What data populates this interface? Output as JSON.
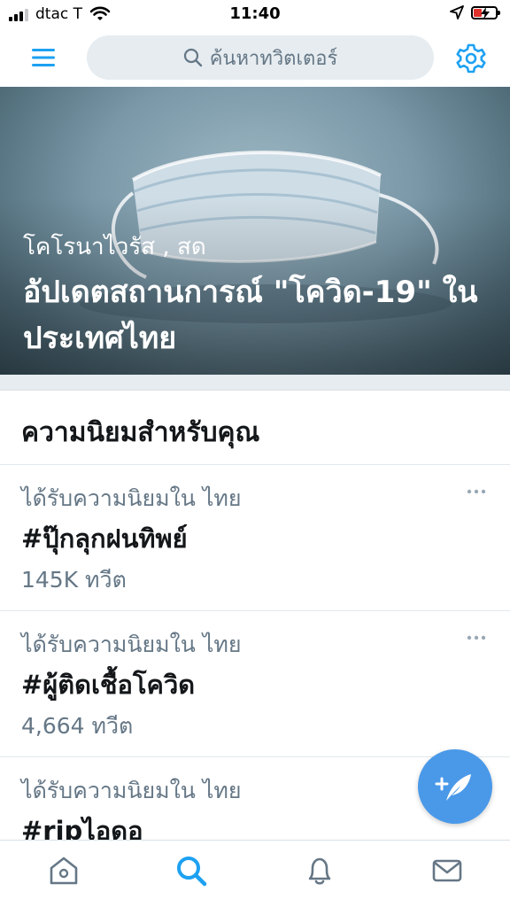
{
  "status_bar": {
    "carrier": "dtac T",
    "time": "11:40"
  },
  "top_nav": {
    "search_placeholder": "ค้นหาทวิตเตอร์",
    "icons": [
      "menu-icon",
      "search-icon",
      "gear-icon"
    ]
  },
  "hero": {
    "kicker": "โคโรนาไวรัส , สด",
    "title": "อัปเดตสถานการณ์ \"โควิด-19\" ในประเทศไทย"
  },
  "trends": {
    "heading": "ความนิยมสำหรับคุณ",
    "items": [
      {
        "context": "ได้รับความนิยมใน ไทย",
        "name": "#ปุ๊กลุกฝนทิพย์",
        "count": "145K ทวีต"
      },
      {
        "context": "ได้รับความนิยมใน ไทย",
        "name": "#ผู้ติดเชื้อโควิด",
        "count": "4,664 ทวีต"
      },
      {
        "context": "ได้รับความนิยมใน ไทย",
        "name": "#ripไอดอ",
        "count": ""
      }
    ]
  },
  "tab_bar": {
    "tabs": [
      "home-icon",
      "search-icon",
      "bell-icon",
      "mail-icon"
    ],
    "active": "search-icon"
  },
  "colors": {
    "accent": "#1da1f2",
    "fab": "#4a99e9",
    "secondary_text": "#657786",
    "primary_text": "#14171a",
    "search_bg": "#e6ecf0",
    "battery_low": "#e0322b"
  }
}
